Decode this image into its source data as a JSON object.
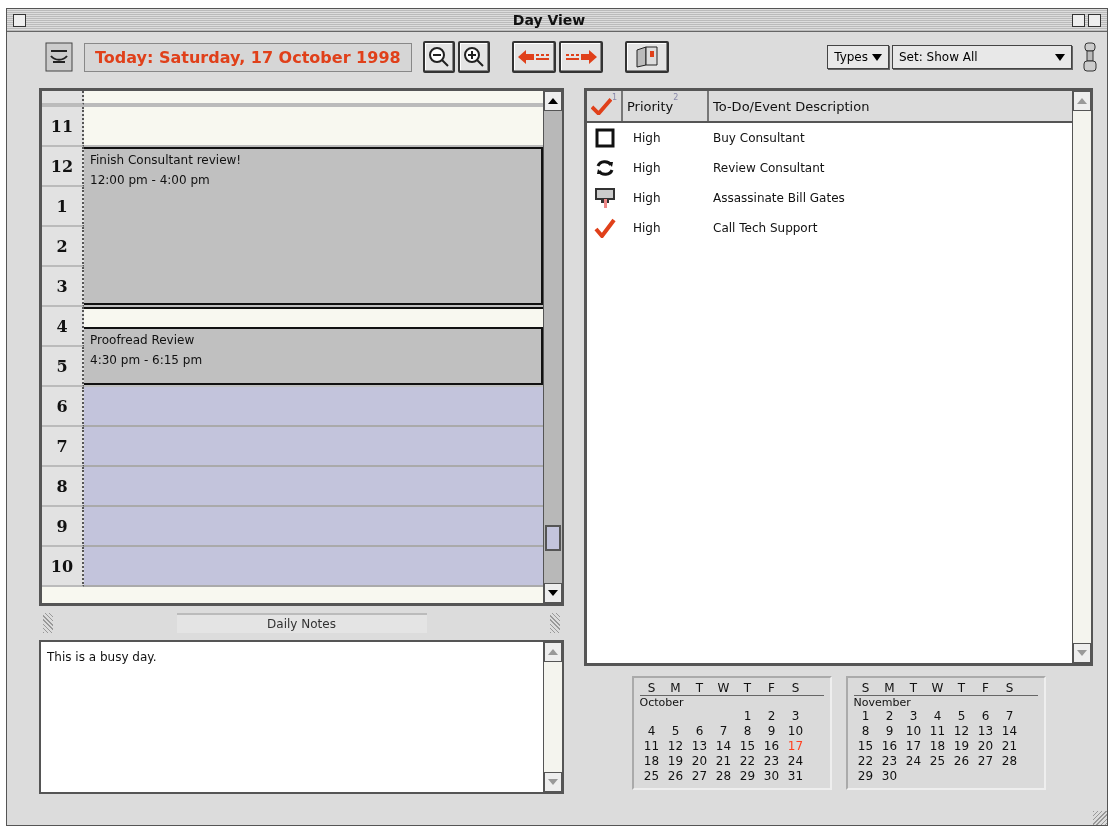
{
  "window": {
    "title": "Day View"
  },
  "toolbar": {
    "date": "Today: Saturday, 17 October 1998",
    "types": "Types",
    "set": "Set: Show All"
  },
  "day_grid": {
    "hours": [
      {
        "label": "11",
        "kind": "free"
      },
      {
        "label": "12",
        "kind": "busy",
        "event": {
          "title": "Finish Consultant review!",
          "time": "12:00 pm - 4:00 pm"
        }
      },
      {
        "label": "1",
        "kind": "busy"
      },
      {
        "label": "2",
        "kind": "busy"
      },
      {
        "label": "3",
        "kind": "busy"
      },
      {
        "label": "4",
        "kind": "half",
        "event": {
          "title": "Proofread Review",
          "time": "4:30 pm - 6:15 pm"
        }
      },
      {
        "label": "5",
        "kind": "busy"
      },
      {
        "label": "6",
        "kind": "evening"
      },
      {
        "label": "7",
        "kind": "evening"
      },
      {
        "label": "8",
        "kind": "evening"
      },
      {
        "label": "9",
        "kind": "evening"
      },
      {
        "label": "10",
        "kind": "evening"
      }
    ]
  },
  "notes": {
    "title": "Daily Notes",
    "text": "This is a busy day."
  },
  "todo": {
    "columns": [
      {
        "kind": "check",
        "sort": "1"
      },
      {
        "label": "Priority",
        "sort": "2"
      },
      {
        "label": "To-Do/Event Description"
      }
    ],
    "rows": [
      {
        "kind": "todo",
        "priority": "High",
        "description": "Buy Consultant"
      },
      {
        "kind": "recurring",
        "priority": "High",
        "description": "Review Consultant"
      },
      {
        "kind": "event",
        "priority": "High",
        "description": "Assassinate Bill Gates"
      },
      {
        "kind": "done",
        "priority": "High",
        "description": "Call Tech Support"
      }
    ]
  },
  "calendars": [
    {
      "weekdays": [
        "S",
        "M",
        "T",
        "W",
        "T",
        "F",
        "S"
      ],
      "month": "October",
      "weeks": [
        [
          {
            "d": "1",
            "selected": false
          },
          {
            "d": "2",
            "selected": false
          },
          {
            "d": "3",
            "selected": false
          }
        ],
        [
          {
            "d": "4",
            "selected": false
          },
          {
            "d": "5",
            "selected": false
          },
          {
            "d": "6",
            "selected": false
          },
          {
            "d": "7",
            "selected": false
          },
          {
            "d": "8",
            "selected": false
          },
          {
            "d": "9",
            "selected": false
          },
          {
            "d": "10",
            "selected": false
          }
        ],
        [
          {
            "d": "11",
            "selected": false
          },
          {
            "d": "12",
            "selected": false
          },
          {
            "d": "13",
            "selected": false
          },
          {
            "d": "14",
            "selected": false
          },
          {
            "d": "15",
            "selected": false
          },
          {
            "d": "16",
            "selected": false
          },
          {
            "d": "17",
            "selected": true
          }
        ],
        [
          {
            "d": "18",
            "selected": false
          },
          {
            "d": "19",
            "selected": false
          },
          {
            "d": "20",
            "selected": false
          },
          {
            "d": "21",
            "selected": false
          },
          {
            "d": "22",
            "selected": false
          },
          {
            "d": "23",
            "selected": false
          },
          {
            "d": "24",
            "selected": false
          }
        ],
        [
          {
            "d": "25",
            "selected": false
          },
          {
            "d": "26",
            "selected": false
          },
          {
            "d": "27",
            "selected": false
          },
          {
            "d": "28",
            "selected": false
          },
          {
            "d": "29",
            "selected": false
          },
          {
            "d": "30",
            "selected": false
          },
          {
            "d": "31",
            "selected": false
          }
        ]
      ]
    },
    {
      "weekdays": [
        "S",
        "M",
        "T",
        "W",
        "T",
        "F",
        "S"
      ],
      "month": "November",
      "weeks": [
        [
          {
            "d": "1",
            "selected": false
          },
          {
            "d": "2",
            "selected": false
          },
          {
            "d": "3",
            "selected": false
          },
          {
            "d": "4",
            "selected": false
          },
          {
            "d": "5",
            "selected": false
          },
          {
            "d": "6",
            "selected": false
          },
          {
            "d": "7",
            "selected": false
          }
        ],
        [
          {
            "d": "8",
            "selected": false
          },
          {
            "d": "9",
            "selected": false
          },
          {
            "d": "10",
            "selected": false
          },
          {
            "d": "11",
            "selected": false
          },
          {
            "d": "12",
            "selected": false
          },
          {
            "d": "13",
            "selected": false
          },
          {
            "d": "14",
            "selected": false
          }
        ],
        [
          {
            "d": "15",
            "selected": false
          },
          {
            "d": "16",
            "selected": false
          },
          {
            "d": "17",
            "selected": false
          },
          {
            "d": "18",
            "selected": false
          },
          {
            "d": "19",
            "selected": false
          },
          {
            "d": "20",
            "selected": false
          },
          {
            "d": "21",
            "selected": false
          }
        ],
        [
          {
            "d": "22",
            "selected": false
          },
          {
            "d": "23",
            "selected": false
          },
          {
            "d": "24",
            "selected": false
          },
          {
            "d": "25",
            "selected": false
          },
          {
            "d": "26",
            "selected": false
          },
          {
            "d": "27",
            "selected": false
          },
          {
            "d": "28",
            "selected": false
          }
        ],
        [
          {
            "d": "29",
            "selected": false
          },
          {
            "d": "30",
            "selected": false
          }
        ]
      ]
    }
  ]
}
